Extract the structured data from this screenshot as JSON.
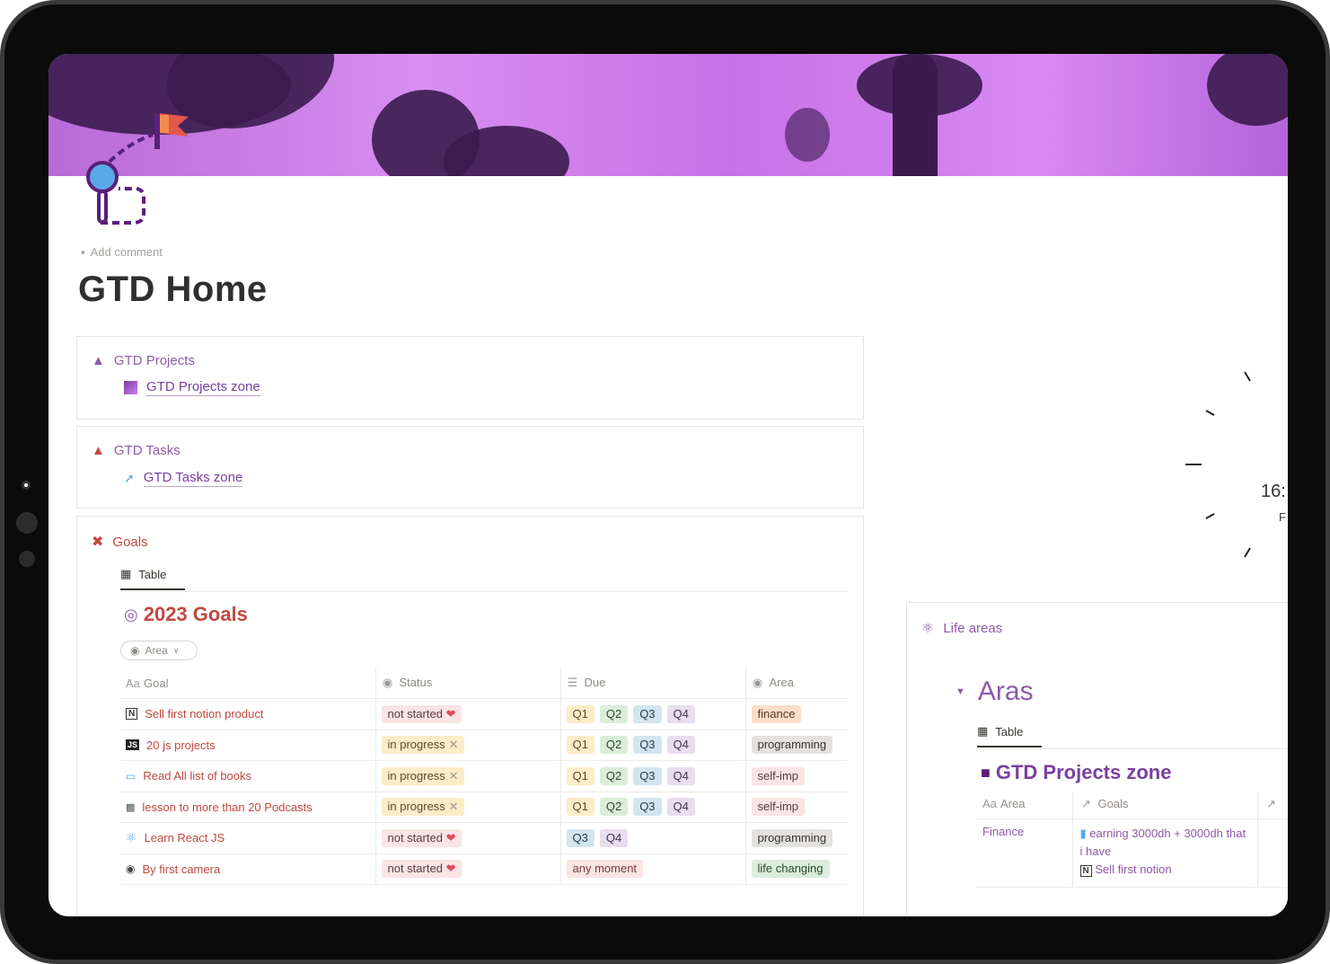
{
  "page": {
    "add_comment": "Add comment",
    "title": "GTD Home"
  },
  "projects_card": {
    "heading": "GTD Projects",
    "link": "GTD Projects zone"
  },
  "tasks_card": {
    "heading": "GTD Tasks",
    "link": "GTD Tasks zone"
  },
  "goals_card": {
    "heading": "Goals",
    "tab": "Table",
    "db_title": "2023 Goals",
    "filter": "Area",
    "columns": {
      "goal": "Goal",
      "status": "Status",
      "due": "Due",
      "area": "Area"
    },
    "rows": [
      {
        "goal": "Sell first notion product",
        "status": "not started",
        "due": [
          "Q1",
          "Q2",
          "Q3",
          "Q4"
        ],
        "area": "finance"
      },
      {
        "goal": "20 js projects",
        "status": "in progress",
        "due": [
          "Q1",
          "Q2",
          "Q3",
          "Q4"
        ],
        "area": "programming"
      },
      {
        "goal": "Read All list of books",
        "status": "in progress",
        "due": [
          "Q1",
          "Q2",
          "Q3",
          "Q4"
        ],
        "area": "self-imp"
      },
      {
        "goal": "lesson to more than 20 Podcasts",
        "status": "in progress",
        "due": [
          "Q1",
          "Q2",
          "Q3",
          "Q4"
        ],
        "area": "self-imp"
      },
      {
        "goal": "Learn React JS",
        "status": "not started",
        "due": [
          "Q3",
          "Q4"
        ],
        "area": "programming"
      },
      {
        "goal": "By first camera",
        "status": "not started",
        "due": [
          "any moment"
        ],
        "area": "life changing"
      }
    ]
  },
  "clock": {
    "time": "16:",
    "day": "F"
  },
  "life_areas": {
    "heading": "Life areas",
    "toggle_title": "Aras",
    "tab": "Table",
    "db_title": "GTD Projects zone",
    "columns": {
      "area": "Area",
      "goals": "Goals"
    },
    "row": {
      "area": "Finance",
      "goal1": "earning 3000dh + 3000dh that i have",
      "goal2": "Sell first notion"
    }
  },
  "colors": {
    "accent_purple": "#8e5aa8",
    "accent_red": "#c2483f"
  }
}
